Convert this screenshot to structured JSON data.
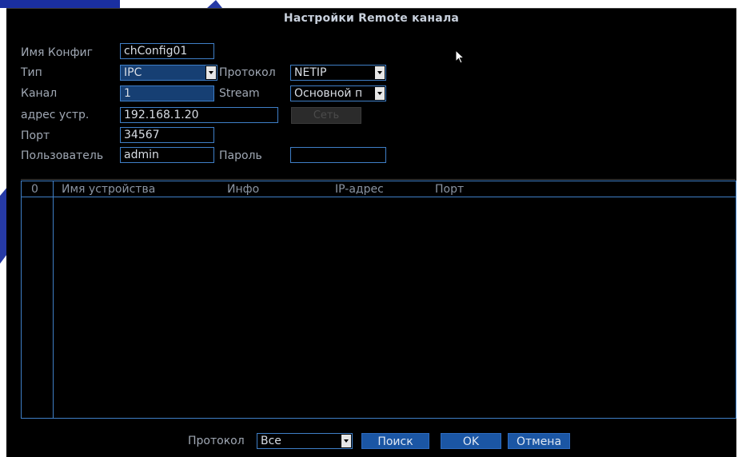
{
  "dialog": {
    "title": "Настройки Remote канала"
  },
  "form": {
    "config_name_label": "Имя Конфиг",
    "config_name_value": "chConfig01",
    "type_label": "Тип",
    "type_value": "IPC",
    "protocol_label": "Протокол",
    "protocol_value": "NETIP",
    "channel_label": "Канал",
    "channel_value": "1",
    "stream_label": "Stream",
    "stream_value": "Основной п",
    "address_label": "адрес устр.",
    "address_value": "192.168.1.20",
    "network_button": "Сеть",
    "port_label": "Порт",
    "port_value": "34567",
    "user_label": "Пользователь",
    "user_value": "admin",
    "password_label": "Пароль",
    "password_value": ""
  },
  "table": {
    "count": "0",
    "columns": [
      "Имя устройства",
      "Инфо",
      "IP-адрес",
      "Порт"
    ],
    "rows": []
  },
  "footer": {
    "protocol_label": "Протокол",
    "protocol_value": "Все",
    "search_button": "Поиск",
    "ok_button": "OK",
    "cancel_button": "Отмена"
  },
  "colors": {
    "background": "#000000",
    "accent": "#3f7fc7",
    "selected_fill": "#163f73",
    "button_fill": "#1b56a4",
    "watermark": "#1a2fa0"
  }
}
